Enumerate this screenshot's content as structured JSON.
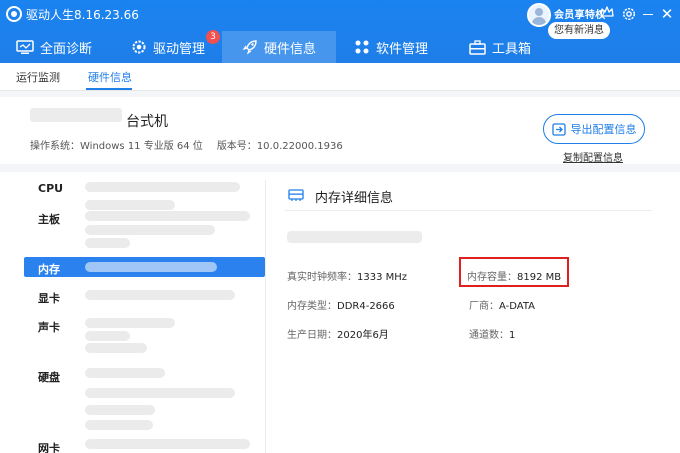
{
  "app": {
    "title": "驱动人生8.16.23.66"
  },
  "account": {
    "vip_label": "会员享特权",
    "message_bubble": "您有新消息"
  },
  "nav": {
    "tabs": [
      {
        "label": "全面诊断",
        "icon": "monitor-icon"
      },
      {
        "label": "驱动管理",
        "icon": "gear-icon"
      },
      {
        "label": "硬件信息",
        "icon": "rocket-icon"
      },
      {
        "label": "软件管理",
        "icon": "apps-icon"
      },
      {
        "label": "工具箱",
        "icon": "toolbox-icon"
      }
    ],
    "active_tab": "硬件信息",
    "driver_badge": "3"
  },
  "subtabs": {
    "items": [
      "运行监测",
      "硬件信息"
    ],
    "active": "硬件信息"
  },
  "system": {
    "machine_type": "台式机",
    "os_label": "操作系统：",
    "os_value": "Windows 11 专业版 64 位",
    "version_label": "版本号：",
    "version_value": "10.0.22000.1936"
  },
  "actions": {
    "export_label": "导出配置信息",
    "copy_label": "复制配置信息"
  },
  "categories": [
    "CPU",
    "主板",
    "内存",
    "显卡",
    "声卡",
    "硬盘",
    "网卡"
  ],
  "active_category": "内存",
  "memory": {
    "title": "内存详细信息",
    "frequency_label": "真实时钟频率：",
    "frequency_value": "1333 MHz",
    "capacity_label": "内存容量：",
    "capacity_value": "8192 MB",
    "type_label": "内存类型：",
    "type_value": "DDR4-2666",
    "vendor_label": "厂商：",
    "vendor_value": "A-DATA",
    "date_label": "生产日期：",
    "date_value": "2020年6月",
    "channels_label": "通道数：",
    "channels_value": "1"
  },
  "colors": {
    "brand": "#1f7ee8",
    "highlight": "#e02020",
    "badge": "#f05050"
  }
}
